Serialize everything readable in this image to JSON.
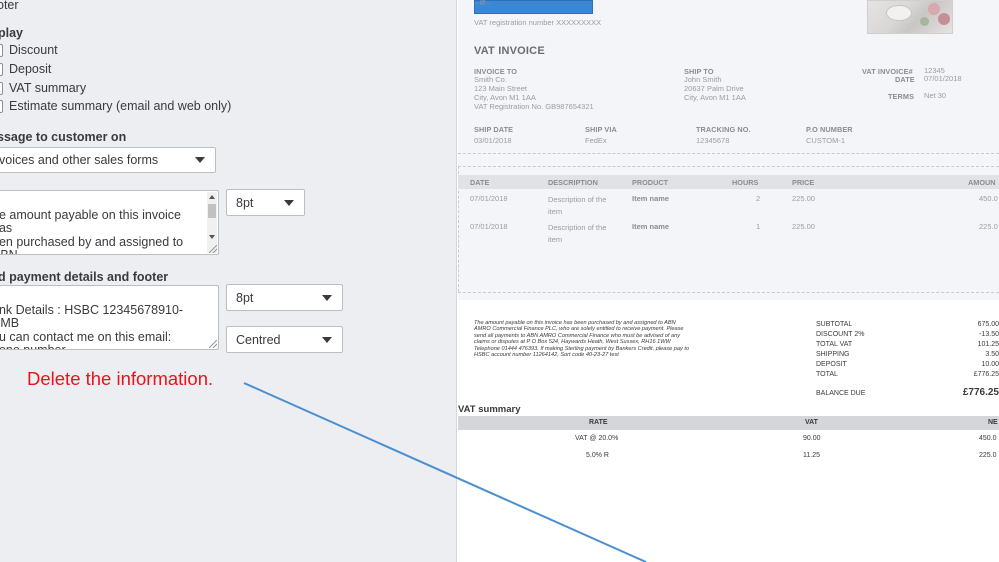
{
  "settings": {
    "footer_label": "oter",
    "display_label": "play",
    "display_options": [
      "Discount",
      "Deposit",
      "VAT summary",
      "Estimate summary (email and web only)"
    ],
    "message_label": "ssage to customer on",
    "message_select": "voices and other sales forms",
    "message_text": "he amount payable on this invoice has\neen purchased by and assigned to ABN\nMRO Commercial Finance PLC, who are\nolely entitled to receive payment. Please\nnd all payments to ABN AMRO",
    "message_font_size": "8pt",
    "footer_section_label": "d payment details and footer",
    "footer_text": "ank Details : HSBC 12345678910- SMB\nou can contact me on this email:\nhone number\nobile:",
    "footer_font_size": "8pt",
    "footer_alignment": "Centred"
  },
  "annotation": {
    "text": "Delete the information.",
    "color": "#e8131b"
  },
  "invoice": {
    "company_email_partial": "...@...",
    "vat_registration": "VAT registration number XXXXXXXXX",
    "title": "VAT INVOICE",
    "invoice_to_label": "INVOICE TO",
    "invoice_to": [
      "Smith Co.",
      "123 Main Street",
      "City, Avon M1 1AA",
      "VAT Registration No. GB987654321"
    ],
    "ship_to_label": "SHIP TO",
    "ship_to": [
      "John Smith",
      "20637 Palm Drive",
      "City, Avon M1 1AA"
    ],
    "vat_invoice_no_label": "VAT INVOICE#",
    "vat_invoice_no": "12345",
    "date_label": "DATE",
    "date": "07/01/2018",
    "terms_label": "TERMS",
    "terms": "Net 30",
    "ship_date_label": "SHIP DATE",
    "ship_date": "03/01/2018",
    "ship_via_label": "SHIP VIA",
    "ship_via": "FedEx",
    "tracking_label": "TRACKING NO.",
    "tracking": "12345678",
    "po_label": "P.O NUMBER",
    "po": "CUSTOM-1",
    "columns": [
      "DATE",
      "DESCRIPTION",
      "PRODUCT",
      "HOURS",
      "PRICE",
      "AMOUN"
    ],
    "lines": [
      {
        "date": "07/01/2018",
        "desc1": "Description of the",
        "desc2": "item",
        "product": "Item name",
        "hours": "2",
        "price": "225.00",
        "amount": "450.0"
      },
      {
        "date": "07/01/2018",
        "desc1": "Description of the",
        "desc2": "item",
        "product": "Item name",
        "hours": "1",
        "price": "225.00",
        "amount": "225.0"
      }
    ],
    "footer_message": "The amount payable on this invoice has been purchased by and assigned to ABN AMRO Commercial Finance PLC, who are solely entitled to receive payment. Please send all payments to ABN AMRO Commercial Finance who must be advised of any claims or disputes at P O Box 524, Haywards Heath, West Sussex, RH16 1WW Telephone 01444 476393. If making Sterling payment by Bankers Credit, please pay to HSBC account number 11264142, Sort code 40-23-27 test",
    "totals": [
      {
        "label": "SUBTOTAL",
        "value": "675.00"
      },
      {
        "label": "DISCOUNT 2%",
        "value": "-13.50"
      },
      {
        "label": "TOTAL VAT",
        "value": "101.25"
      },
      {
        "label": "SHIPPING",
        "value": "3.50"
      },
      {
        "label": "DEPOSIT",
        "value": "10.00"
      },
      {
        "label": "TOTAL",
        "value": "£776.25"
      }
    ],
    "balance_due_label": "BALANCE DUE",
    "balance_due": "£776.25",
    "vat_summary_title": "VAT summary",
    "vat_columns": [
      "RATE",
      "VAT",
      "NE"
    ],
    "vat_rows": [
      {
        "rate": "VAT @ 20.0%",
        "vat": "90.00",
        "net": "450.0"
      },
      {
        "rate": "5.0% R",
        "vat": "11.25",
        "net": "225.0"
      }
    ]
  }
}
